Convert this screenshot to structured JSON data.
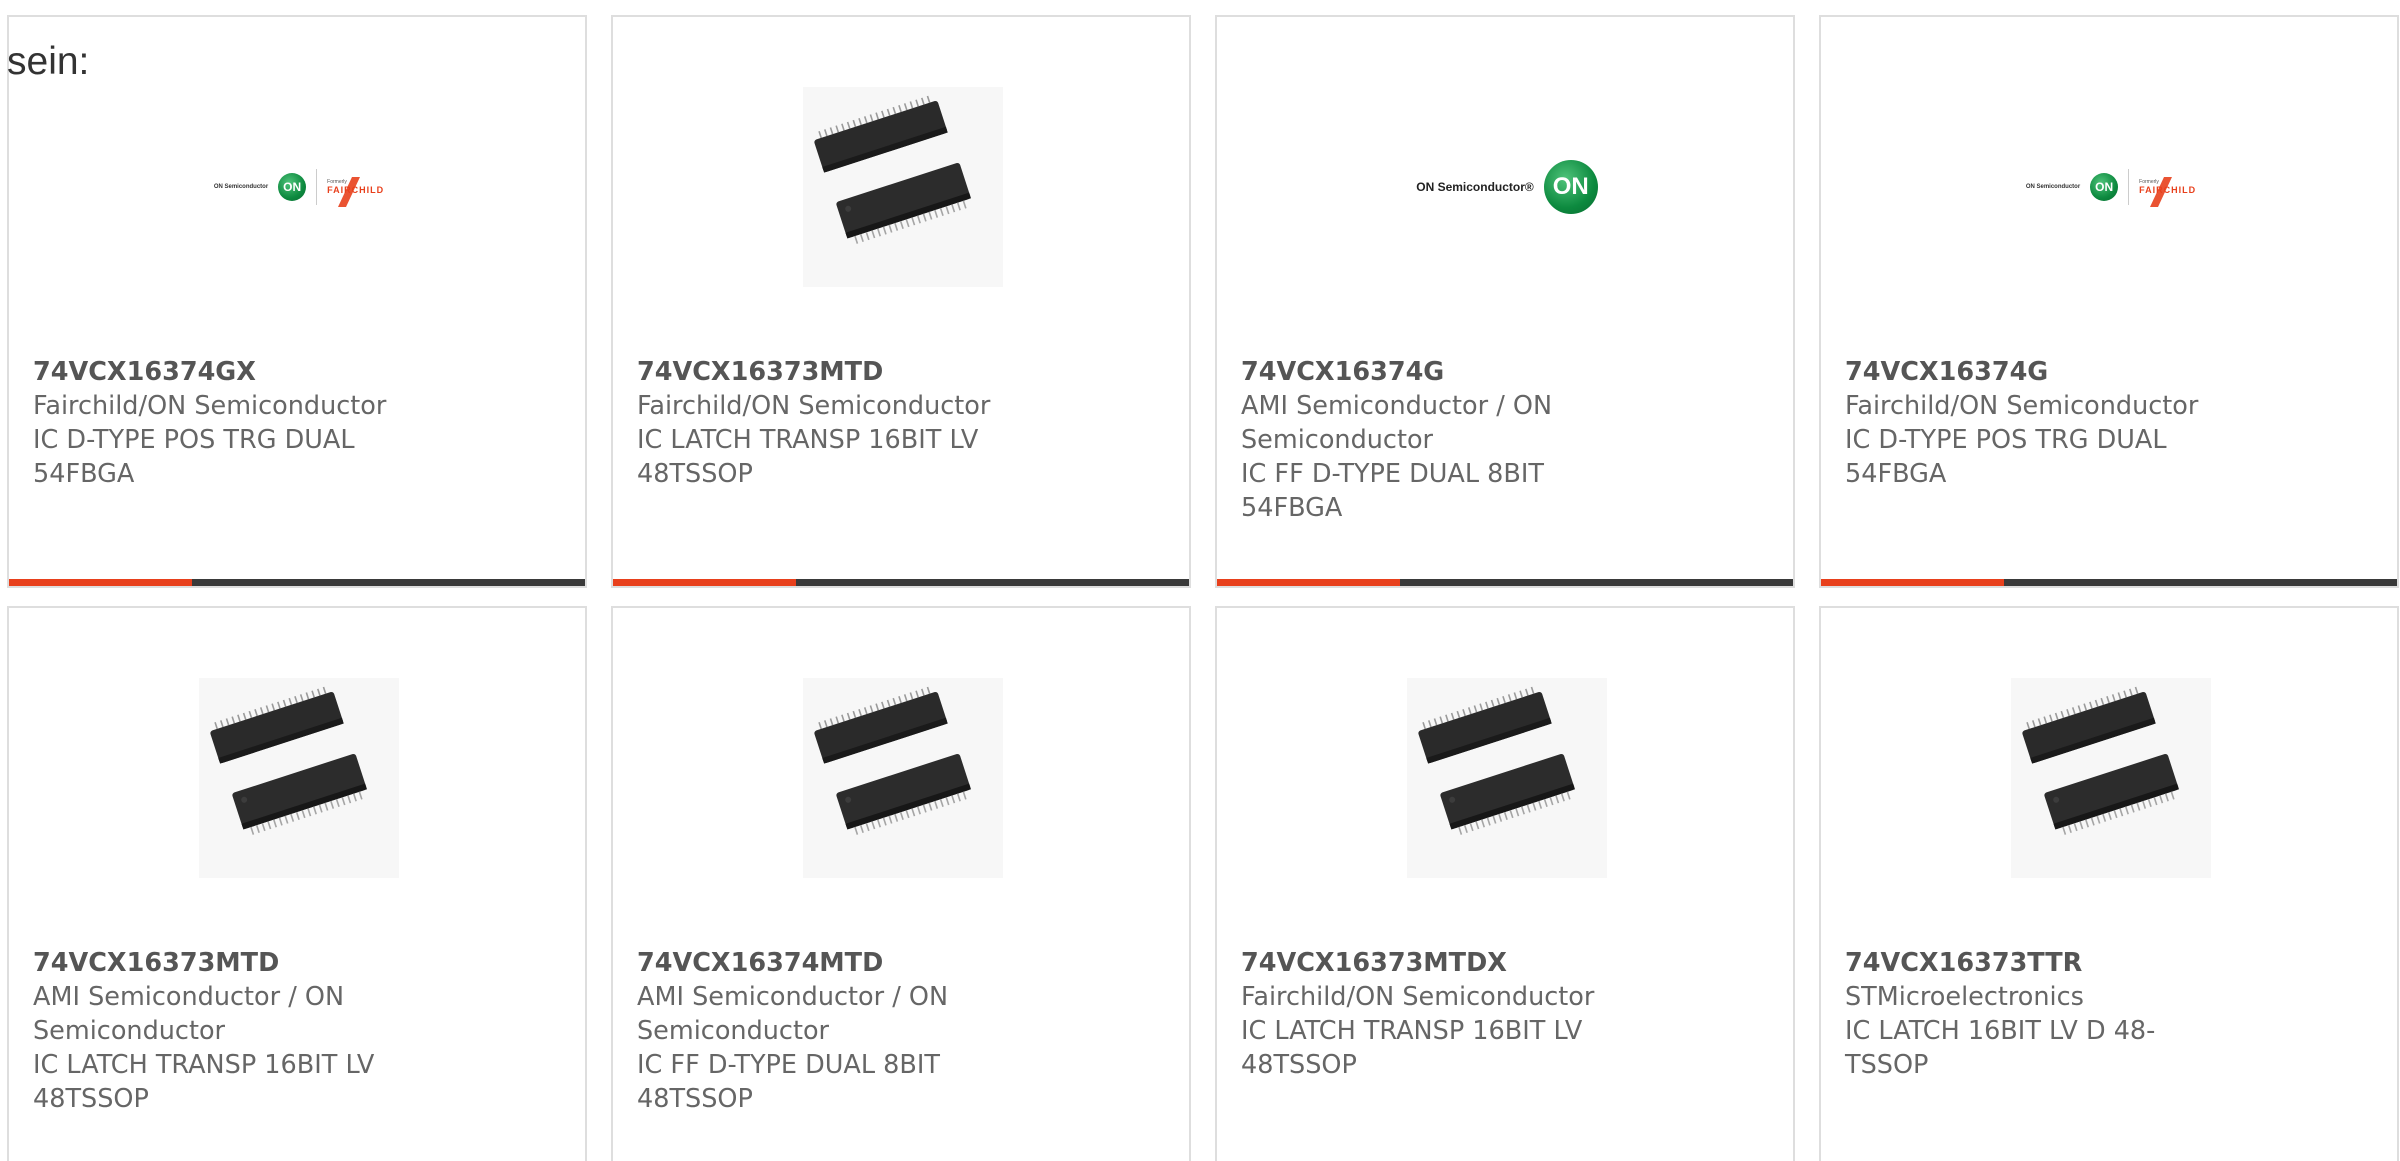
{
  "intro_text": "sein:",
  "colors": {
    "accent": "#e8401c",
    "bar": "#3a3a3a",
    "border": "#dedede",
    "text": "#666666"
  },
  "products": [
    {
      "part_number": "74VCX16374GX",
      "manufacturer": "Fairchild/ON Semiconductor",
      "description": "IC D-TYPE POS TRG DUAL 54FBGA",
      "image": "onsemi-fairchild-logo",
      "logo_brand": "ON Semiconductor",
      "logo_formerly": "Formerly",
      "logo_fairchild": "FAIRCHILD",
      "logo_on": "ON"
    },
    {
      "part_number": "74VCX16373MTD",
      "manufacturer": "Fairchild/ON Semiconductor",
      "description": "IC LATCH TRANSP 16BIT LV 48TSSOP",
      "image": "tssop-chip-photo"
    },
    {
      "part_number": "74VCX16374G",
      "manufacturer": "AMI Semiconductor / ON Semiconductor",
      "description": "IC FF D-TYPE DUAL 8BIT 54FBGA",
      "image": "onsemi-logo",
      "logo_brand": "ON Semiconductor®",
      "logo_on": "ON"
    },
    {
      "part_number": "74VCX16374G",
      "manufacturer": "Fairchild/ON Semiconductor",
      "description": "IC D-TYPE POS TRG DUAL 54FBGA",
      "image": "onsemi-fairchild-logo",
      "logo_brand": "ON Semiconductor",
      "logo_formerly": "Formerly",
      "logo_fairchild": "FAIRCHILD",
      "logo_on": "ON"
    },
    {
      "part_number": "74VCX16373MTD",
      "manufacturer": "AMI Semiconductor / ON Semiconductor",
      "description": "IC LATCH TRANSP 16BIT LV 48TSSOP",
      "image": "tssop-chip-photo"
    },
    {
      "part_number": "74VCX16374MTD",
      "manufacturer": "AMI Semiconductor / ON Semiconductor",
      "description": "IC FF D-TYPE DUAL 8BIT 48TSSOP",
      "image": "tssop-chip-photo"
    },
    {
      "part_number": "74VCX16373MTDX",
      "manufacturer": "Fairchild/ON Semiconductor",
      "description": "IC LATCH TRANSP 16BIT LV 48TSSOP",
      "image": "tssop-chip-photo"
    },
    {
      "part_number": "74VCX16373TTR",
      "manufacturer": "STMicroelectronics",
      "description": "IC LATCH 16BIT LV D 48-TSSOP",
      "image": "tssop-chip-photo"
    }
  ]
}
